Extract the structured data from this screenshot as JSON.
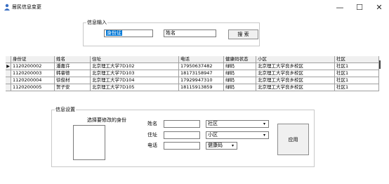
{
  "window": {
    "title": "居民信息变更",
    "min_glyph": "—",
    "max_glyph": "☐",
    "close_glyph": "✕"
  },
  "search": {
    "group_label": "信息输入",
    "id_field_value": "身份证",
    "name_field_value": "姓名",
    "search_button": "搜 索"
  },
  "grid": {
    "columns": [
      "身份证",
      "姓名",
      "住址",
      "电话",
      "健康码状态",
      "小区",
      "社区"
    ],
    "rows": [
      [
        "1120200002",
        "潘嘉许",
        "北京理工大学7D102",
        "17950637482",
        "绿码",
        "北京理工大学良乡校区",
        "社区1"
      ],
      [
        "1120200003",
        "韩睿德",
        "北京理工大学7D103",
        "18173158947",
        "绿码",
        "北京理工大学良乡校区",
        "社区1"
      ],
      [
        "1120200004",
        "徐俊材",
        "北京理工大学7D104",
        "17929947310",
        "绿码",
        "北京理工大学良乡校区",
        "社区1"
      ],
      [
        "1120200005",
        "贺子安",
        "北京理工大学7D105",
        "18115913859",
        "绿码",
        "北京理工大学良乡校区",
        "社区1"
      ]
    ],
    "current_row_marker": "▶"
  },
  "settings": {
    "group_label": "信息设置",
    "select_prompt": "选择要修改的身份",
    "name_label": "姓名",
    "address_label": "住址",
    "phone_label": "电话",
    "community_combo": "社区",
    "neighborhood_combo": "小区",
    "health_combo": "健康码",
    "apply_button": "应用",
    "combo_arrow": "▾"
  }
}
